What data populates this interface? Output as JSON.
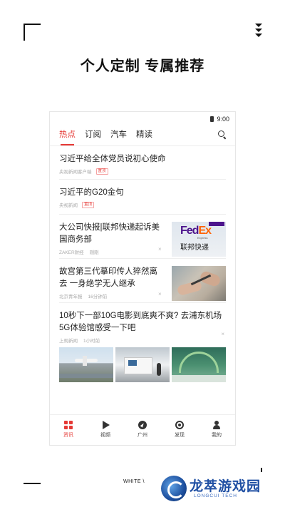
{
  "headline": "个人定制  专属推荐",
  "status": {
    "time": "9:00"
  },
  "tabs": [
    {
      "label": "热点",
      "active": true
    },
    {
      "label": "订阅",
      "active": false
    },
    {
      "label": "汽车",
      "active": false
    },
    {
      "label": "精读",
      "active": false
    }
  ],
  "feed": [
    {
      "title": "习近平给全体党员说初心使命",
      "source": "央视新闻客户端",
      "tag": "置顶"
    },
    {
      "title": "习近平的G20金句",
      "source": "央视新闻",
      "tag": "置顶"
    },
    {
      "title": "大公司快报|联邦快递起诉美国商务部",
      "source": "ZAKER财经",
      "time": "刚刚",
      "thumb": {
        "logo_fe": "Fed",
        "logo_ex": "Ex",
        "sub": "Express",
        "cn": "联邦快递"
      }
    },
    {
      "title": "故宫第三代摹印传人猝然离去 一身绝学无人继承",
      "source": "北京青年报",
      "time": "16分钟前"
    },
    {
      "title": "10秒下一部10G电影到底爽不爽? 去浦东机场5G体验馆感受一下吧",
      "source": "上观新闻",
      "time": "1小时前"
    }
  ],
  "close_glyph": "×",
  "bottom_nav": [
    {
      "label": "资讯",
      "icon": "grid-icon",
      "active": true
    },
    {
      "label": "视频",
      "icon": "play-icon",
      "active": false
    },
    {
      "label": "广州",
      "icon": "compass-icon",
      "active": false
    },
    {
      "label": "发现",
      "icon": "discover-icon",
      "active": false
    },
    {
      "label": "我的",
      "icon": "user-icon",
      "active": false
    }
  ],
  "footer_text": "WHITE \\",
  "watermark": {
    "title": "龙萃游戏园",
    "subtitle": "LONGCUI TECH"
  },
  "colors": {
    "accent": "#e53935",
    "text": "#222222",
    "meta": "#aaaaaa"
  }
}
